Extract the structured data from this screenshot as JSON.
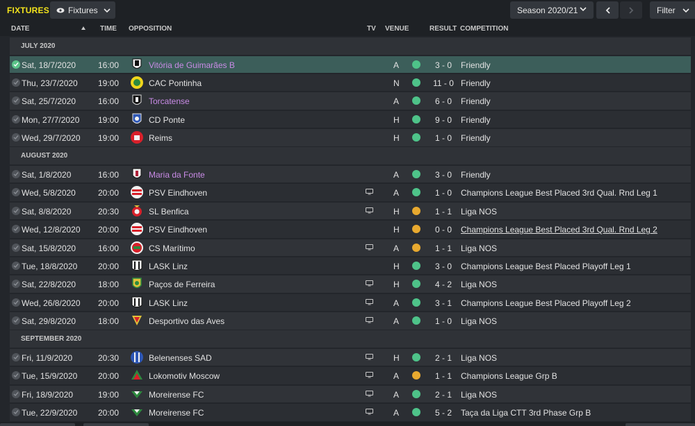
{
  "topbar": {
    "title": "FIXTURES",
    "view_label": "Fixtures",
    "season_label": "Season 2020/21",
    "filter_label": "Filter"
  },
  "columns": {
    "date": "DATE",
    "time": "TIME",
    "opposition": "OPPOSITION",
    "tv": "TV",
    "venue": "VENUE",
    "result": "RESULT",
    "competition": "COMPETITION"
  },
  "months": [
    {
      "label": "JULY 2020",
      "fixtures": [
        {
          "date": "Sat, 18/7/2020",
          "time": "16:00",
          "opponent": "Vitória de Guimarães B",
          "crest": "guimaraes-crest",
          "friendly": true,
          "tv": false,
          "venue": "A",
          "outcome": "win",
          "result": "3 - 0",
          "competition": "Friendly",
          "selected": true
        },
        {
          "date": "Thu, 23/7/2020",
          "time": "19:00",
          "opponent": "CAC Pontinha",
          "crest": "pontinha-crest",
          "friendly": false,
          "tv": false,
          "venue": "N",
          "outcome": "win",
          "result": "11 - 0",
          "competition": "Friendly"
        },
        {
          "date": "Sat, 25/7/2020",
          "time": "16:00",
          "opponent": "Torcatense",
          "crest": "torcatense-crest",
          "friendly": true,
          "tv": false,
          "venue": "A",
          "outcome": "win",
          "result": "6 - 0",
          "competition": "Friendly"
        },
        {
          "date": "Mon, 27/7/2020",
          "time": "19:00",
          "opponent": "CD Ponte",
          "crest": "ponte-crest",
          "friendly": false,
          "tv": false,
          "venue": "H",
          "outcome": "win",
          "result": "9 - 0",
          "competition": "Friendly"
        },
        {
          "date": "Wed, 29/7/2020",
          "time": "19:00",
          "opponent": "Reims",
          "crest": "reims-crest",
          "friendly": false,
          "tv": false,
          "venue": "H",
          "outcome": "win",
          "result": "1 - 0",
          "competition": "Friendly"
        }
      ]
    },
    {
      "label": "AUGUST 2020",
      "fixtures": [
        {
          "date": "Sat, 1/8/2020",
          "time": "16:00",
          "opponent": "Maria da Fonte",
          "crest": "maria-da-fonte-crest",
          "friendly": true,
          "tv": false,
          "venue": "A",
          "outcome": "win",
          "result": "3 - 0",
          "competition": "Friendly"
        },
        {
          "date": "Wed, 5/8/2020",
          "time": "20:00",
          "opponent": "PSV Eindhoven",
          "crest": "psv-crest",
          "friendly": false,
          "tv": true,
          "venue": "A",
          "outcome": "win",
          "result": "1 - 0",
          "competition": "Champions League Best Placed 3rd Qual. Rnd Leg 1"
        },
        {
          "date": "Sat, 8/8/2020",
          "time": "20:30",
          "opponent": "SL Benfica",
          "crest": "benfica-crest",
          "friendly": false,
          "tv": true,
          "venue": "H",
          "outcome": "draw",
          "result": "1 - 1",
          "competition": "Liga NOS"
        },
        {
          "date": "Wed, 12/8/2020",
          "time": "20:00",
          "opponent": "PSV Eindhoven",
          "crest": "psv-crest",
          "friendly": false,
          "tv": false,
          "venue": "H",
          "outcome": "draw",
          "result": "0 - 0",
          "competition": "Champions League Best Placed 3rd Qual. Rnd Leg 2",
          "underline": true
        },
        {
          "date": "Sat, 15/8/2020",
          "time": "16:00",
          "opponent": "CS Marítimo",
          "crest": "maritimo-crest",
          "friendly": false,
          "tv": true,
          "venue": "A",
          "outcome": "draw",
          "result": "1 - 1",
          "competition": "Liga NOS"
        },
        {
          "date": "Tue, 18/8/2020",
          "time": "20:00",
          "opponent": "LASK Linz",
          "crest": "lask-crest",
          "friendly": false,
          "tv": false,
          "venue": "H",
          "outcome": "win",
          "result": "3 - 0",
          "competition": "Champions League Best Placed Playoff Leg 1"
        },
        {
          "date": "Sat, 22/8/2020",
          "time": "18:00",
          "opponent": "Paços de Ferreira",
          "crest": "pacos-crest",
          "friendly": false,
          "tv": true,
          "venue": "H",
          "outcome": "win",
          "result": "4 - 2",
          "competition": "Liga NOS"
        },
        {
          "date": "Wed, 26/8/2020",
          "time": "20:00",
          "opponent": "LASK Linz",
          "crest": "lask-crest",
          "friendly": false,
          "tv": true,
          "venue": "A",
          "outcome": "win",
          "result": "3 - 1",
          "competition": "Champions League Best Placed Playoff Leg 2"
        },
        {
          "date": "Sat, 29/8/2020",
          "time": "18:00",
          "opponent": "Desportivo das Aves",
          "crest": "aves-crest",
          "friendly": false,
          "tv": true,
          "venue": "A",
          "outcome": "win",
          "result": "1 - 0",
          "competition": "Liga NOS"
        }
      ]
    },
    {
      "label": "SEPTEMBER 2020",
      "fixtures": [
        {
          "date": "Fri, 11/9/2020",
          "time": "20:30",
          "opponent": "Belenenses SAD",
          "crest": "belenenses-crest",
          "friendly": false,
          "tv": true,
          "venue": "H",
          "outcome": "win",
          "result": "2 - 1",
          "competition": "Liga NOS"
        },
        {
          "date": "Tue, 15/9/2020",
          "time": "20:00",
          "opponent": "Lokomotiv Moscow",
          "crest": "lokomotiv-crest",
          "friendly": false,
          "tv": true,
          "venue": "A",
          "outcome": "draw",
          "result": "1 - 1",
          "competition": "Champions League Grp B"
        },
        {
          "date": "Fri, 18/9/2020",
          "time": "19:00",
          "opponent": "Moreirense FC",
          "crest": "moreirense-crest",
          "friendly": false,
          "tv": true,
          "venue": "A",
          "outcome": "win",
          "result": "2 - 1",
          "competition": "Liga NOS"
        },
        {
          "date": "Tue, 22/9/2020",
          "time": "20:00",
          "opponent": "Moreirense FC",
          "crest": "moreirense-crest",
          "friendly": false,
          "tv": true,
          "venue": "A",
          "outcome": "win",
          "result": "5 - 2",
          "competition": "Taça da Liga CTT 3rd Phase Grp B"
        }
      ]
    }
  ],
  "colors": {
    "title": "#f2e21c",
    "win": "#4ec389",
    "draw": "#e8a92f",
    "friendly_opponent": "#c98be6",
    "selected_row": "#3c5e5a"
  }
}
